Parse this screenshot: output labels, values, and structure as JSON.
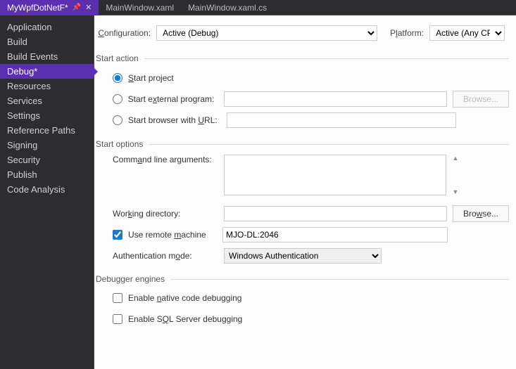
{
  "tabs": {
    "active": {
      "title": "MyWpfDotNetF*"
    },
    "items": [
      "MainWindow.xaml",
      "MainWindow.xaml.cs"
    ]
  },
  "sidebar": {
    "items": [
      "Application",
      "Build",
      "Build Events",
      "Debug*",
      "Resources",
      "Services",
      "Settings",
      "Reference Paths",
      "Signing",
      "Security",
      "Publish",
      "Code Analysis"
    ],
    "selected_index": 3
  },
  "config": {
    "config_label": "Configuration:",
    "config_value": "Active (Debug)",
    "platform_label": "Platform:",
    "platform_value": "Active (Any CPU)"
  },
  "sections": {
    "start_action": {
      "title": "Start action",
      "start_project": "Start project",
      "start_external": "Start external program:",
      "start_browser": "Start browser with URL:",
      "browse": "Browse...",
      "external_value": "",
      "url_value": "",
      "selected": "project"
    },
    "start_options": {
      "title": "Start options",
      "cmd_args_label": "Command line arguments:",
      "cmd_args_value": "",
      "working_dir_label": "Working directory:",
      "working_dir_value": "",
      "browse": "Browse...",
      "use_remote_label": "Use remote machine",
      "use_remote_checked": true,
      "remote_value": "MJO-DL:2046",
      "auth_label": "Authentication mode:",
      "auth_value": "Windows Authentication"
    },
    "debugger_engines": {
      "title": "Debugger engines",
      "native_label": "Enable native code debugging",
      "native_checked": false,
      "sql_label": "Enable SQL Server debugging",
      "sql_checked": false
    }
  }
}
